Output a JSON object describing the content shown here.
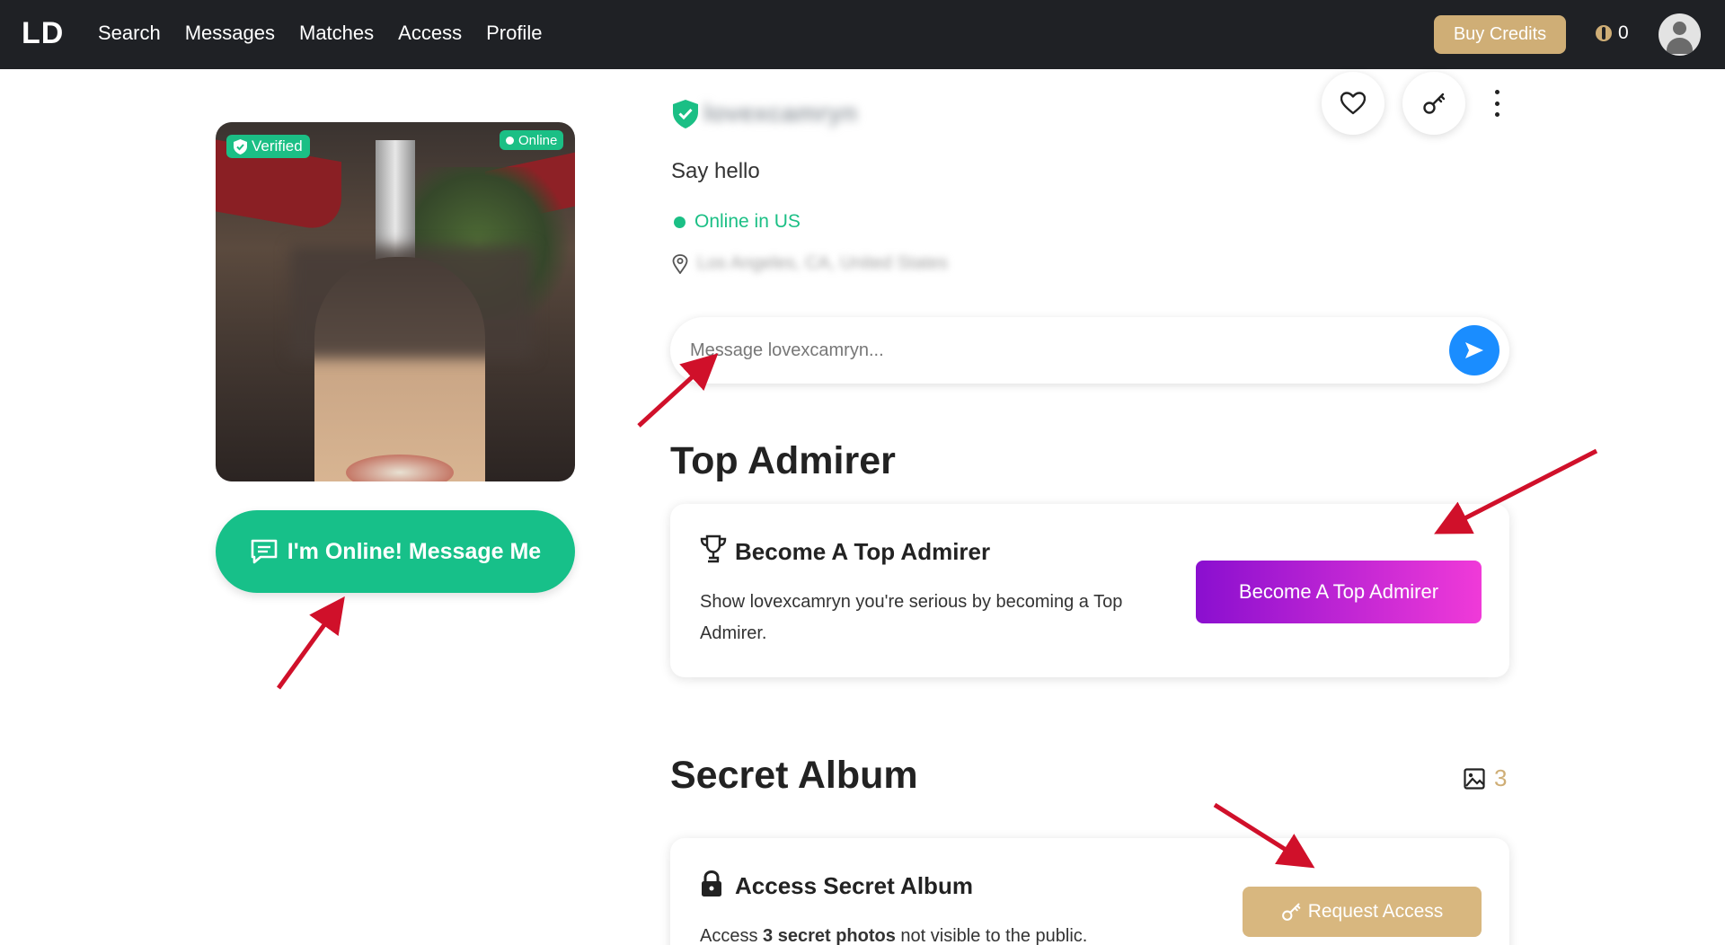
{
  "app": {
    "logo": "LD"
  },
  "nav": {
    "items": [
      "Search",
      "Messages",
      "Matches",
      "Access",
      "Profile"
    ]
  },
  "header": {
    "buy_credits_label": "Buy Credits",
    "credits_count": "0"
  },
  "photo": {
    "verified_label": "Verified",
    "online_label": "Online"
  },
  "message_me_label": "I'm Online! Message Me",
  "profile": {
    "username": "lovexcamryn",
    "greeting": "Say hello",
    "status": "Online in US",
    "location": "Los Angeles, CA, United States"
  },
  "message": {
    "placeholder": "Message lovexcamryn..."
  },
  "top_admirer": {
    "heading": "Top Admirer",
    "card_title": "Become A Top Admirer",
    "description": "Show lovexcamryn you're serious by becoming a Top Admirer.",
    "button_label": "Become A Top Admirer"
  },
  "secret_album": {
    "heading": "Secret Album",
    "photo_count": "3",
    "card_title": "Access Secret Album",
    "description_prefix": "Access ",
    "description_bold": "3 secret photos",
    "description_suffix": " not visible to the public.",
    "button_label": "Request Access"
  },
  "colors": {
    "nav_bg": "#1f2125",
    "accent_green": "#1bbf85",
    "gold": "#cfae76",
    "send_blue": "#1a8dff",
    "gradient_start": "#8a0fcf",
    "gradient_end": "#f03ad8",
    "annotation_red": "#d0102a"
  },
  "icons": [
    "heart-icon",
    "key-icon",
    "more-vertical-icon",
    "send-icon",
    "trophy-icon",
    "lock-icon",
    "image-icon",
    "location-pin-icon",
    "chat-icon",
    "shield-check-icon",
    "coin-icon",
    "user-avatar-icon"
  ]
}
